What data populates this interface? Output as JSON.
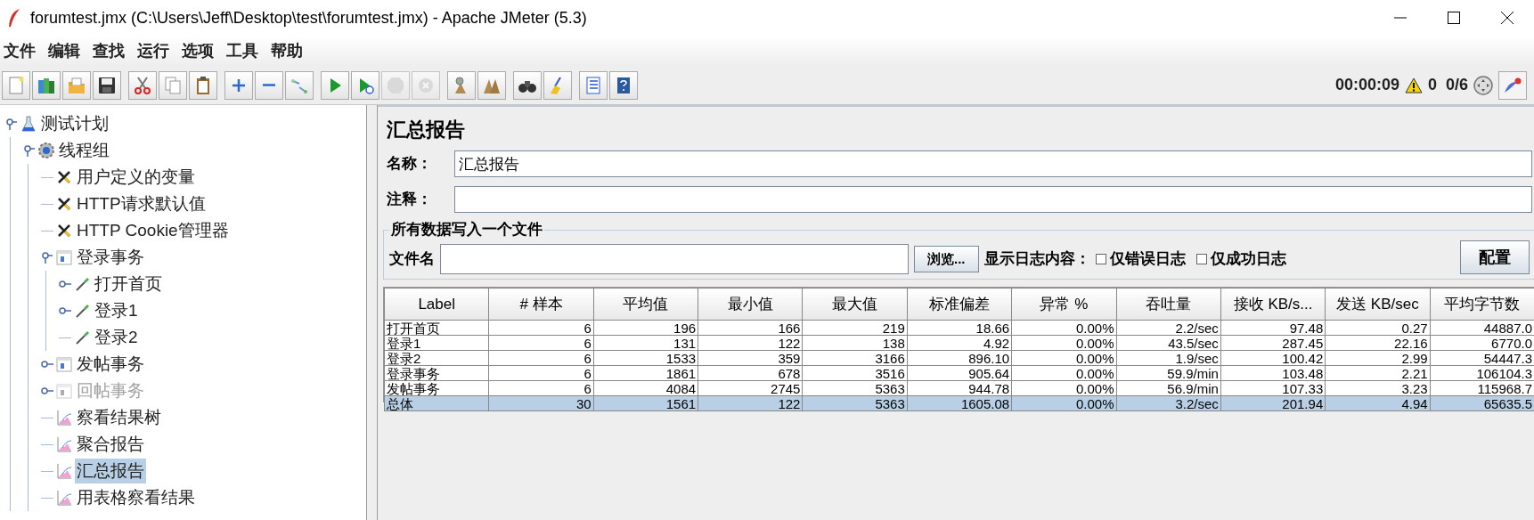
{
  "window": {
    "title": "forumtest.jmx (C:\\Users\\Jeff\\Desktop\\test\\forumtest.jmx) - Apache JMeter (5.3)"
  },
  "menu": [
    "文件",
    "编辑",
    "查找",
    "运行",
    "选项",
    "工具",
    "帮助"
  ],
  "toolbar": [
    [
      {
        "kind": "new",
        "disabled": false
      },
      {
        "kind": "templates",
        "disabled": false
      },
      {
        "kind": "open",
        "disabled": false
      },
      {
        "kind": "save",
        "disabled": false
      }
    ],
    [
      {
        "kind": "cut",
        "disabled": false
      },
      {
        "kind": "copy",
        "disabled": false
      },
      {
        "kind": "paste",
        "disabled": false
      }
    ],
    [
      {
        "kind": "expand",
        "disabled": false
      },
      {
        "kind": "collapse",
        "disabled": false
      },
      {
        "kind": "toggle",
        "disabled": false
      }
    ],
    [
      {
        "kind": "start",
        "disabled": false
      },
      {
        "kind": "start-nopause",
        "disabled": false
      },
      {
        "kind": "stop",
        "disabled": true
      },
      {
        "kind": "shutdown",
        "disabled": true
      }
    ],
    [
      {
        "kind": "clear",
        "disabled": false
      },
      {
        "kind": "clear-all",
        "disabled": false
      }
    ],
    [
      {
        "kind": "search",
        "disabled": false
      },
      {
        "kind": "reset-search",
        "disabled": false
      }
    ],
    [
      {
        "kind": "function-helper",
        "disabled": false
      },
      {
        "kind": "help",
        "disabled": false
      }
    ]
  ],
  "status": {
    "elapsed": "00:00:09",
    "warnings": "0",
    "threads": "0/6"
  },
  "tree": [
    {
      "label": "测试计划",
      "kind": "plan",
      "expanded": true,
      "disabled": false,
      "selected": false,
      "children": [
        {
          "label": "线程组",
          "kind": "thread-group",
          "expanded": true,
          "disabled": false,
          "selected": false,
          "children": [
            {
              "label": "用户定义的变量",
              "kind": "config",
              "disabled": false,
              "selected": false
            },
            {
              "label": "HTTP请求默认值",
              "kind": "config",
              "disabled": false,
              "selected": false
            },
            {
              "label": "HTTP Cookie管理器",
              "kind": "config",
              "disabled": false,
              "selected": false
            },
            {
              "label": "登录事务",
              "kind": "transaction",
              "expanded": true,
              "disabled": false,
              "selected": false,
              "children": [
                {
                  "label": "打开首页",
                  "kind": "sampler",
                  "expanded": false,
                  "disabled": false,
                  "selected": false
                },
                {
                  "label": "登录1",
                  "kind": "sampler",
                  "expanded": false,
                  "disabled": false,
                  "selected": false
                },
                {
                  "label": "登录2",
                  "kind": "sampler",
                  "disabled": false,
                  "selected": false
                }
              ]
            },
            {
              "label": "发帖事务",
              "kind": "transaction",
              "expanded": false,
              "disabled": false,
              "selected": false
            },
            {
              "label": "回帖事务",
              "kind": "transaction",
              "expanded": false,
              "disabled": true,
              "selected": false
            },
            {
              "label": "察看结果树",
              "kind": "listener",
              "disabled": false,
              "selected": false
            },
            {
              "label": "聚合报告",
              "kind": "listener",
              "disabled": false,
              "selected": false
            },
            {
              "label": "汇总报告",
              "kind": "listener",
              "disabled": false,
              "selected": true
            },
            {
              "label": "用表格察看结果",
              "kind": "listener",
              "disabled": false,
              "selected": false
            }
          ]
        }
      ]
    }
  ],
  "panel": {
    "title": "汇总报告",
    "name_label": "名称：",
    "name_value": "汇总报告",
    "comment_label": "注释：",
    "file_group": {
      "legend": "所有数据写入一个文件",
      "file_label": "文件名",
      "browse": "浏览...",
      "log_label": "显示日志内容：",
      "checkboxes": [
        {
          "label": "仅错误日志",
          "checked": false
        },
        {
          "label": "仅成功日志",
          "checked": false
        }
      ],
      "configure": "配置"
    }
  },
  "table": {
    "columns": [
      "Label",
      "# 样本",
      "平均值",
      "最小值",
      "最大值",
      "标准偏差",
      "异常 %",
      "吞吐量",
      "接收 KB/s...",
      "发送 KB/sec",
      "平均字节数"
    ],
    "rows": [
      {
        "selected": false,
        "cells": [
          "打开首页",
          "6",
          "196",
          "166",
          "219",
          "18.66",
          "0.00%",
          "2.2/sec",
          "97.48",
          "0.27",
          "44887.0"
        ]
      },
      {
        "selected": false,
        "cells": [
          "登录1",
          "6",
          "131",
          "122",
          "138",
          "4.92",
          "0.00%",
          "43.5/sec",
          "287.45",
          "22.16",
          "6770.0"
        ]
      },
      {
        "selected": false,
        "cells": [
          "登录2",
          "6",
          "1533",
          "359",
          "3166",
          "896.10",
          "0.00%",
          "1.9/sec",
          "100.42",
          "2.99",
          "54447.3"
        ]
      },
      {
        "selected": false,
        "cells": [
          "登录事务",
          "6",
          "1861",
          "678",
          "3516",
          "905.64",
          "0.00%",
          "59.9/min",
          "103.48",
          "2.21",
          "106104.3"
        ]
      },
      {
        "selected": false,
        "cells": [
          "发帖事务",
          "6",
          "4084",
          "2745",
          "5363",
          "944.78",
          "0.00%",
          "56.9/min",
          "107.33",
          "3.23",
          "115968.7"
        ]
      },
      {
        "selected": true,
        "cells": [
          "总体",
          "30",
          "1561",
          "122",
          "5363",
          "1605.08",
          "0.00%",
          "3.2/sec",
          "201.94",
          "4.94",
          "65635.5"
        ]
      }
    ]
  }
}
